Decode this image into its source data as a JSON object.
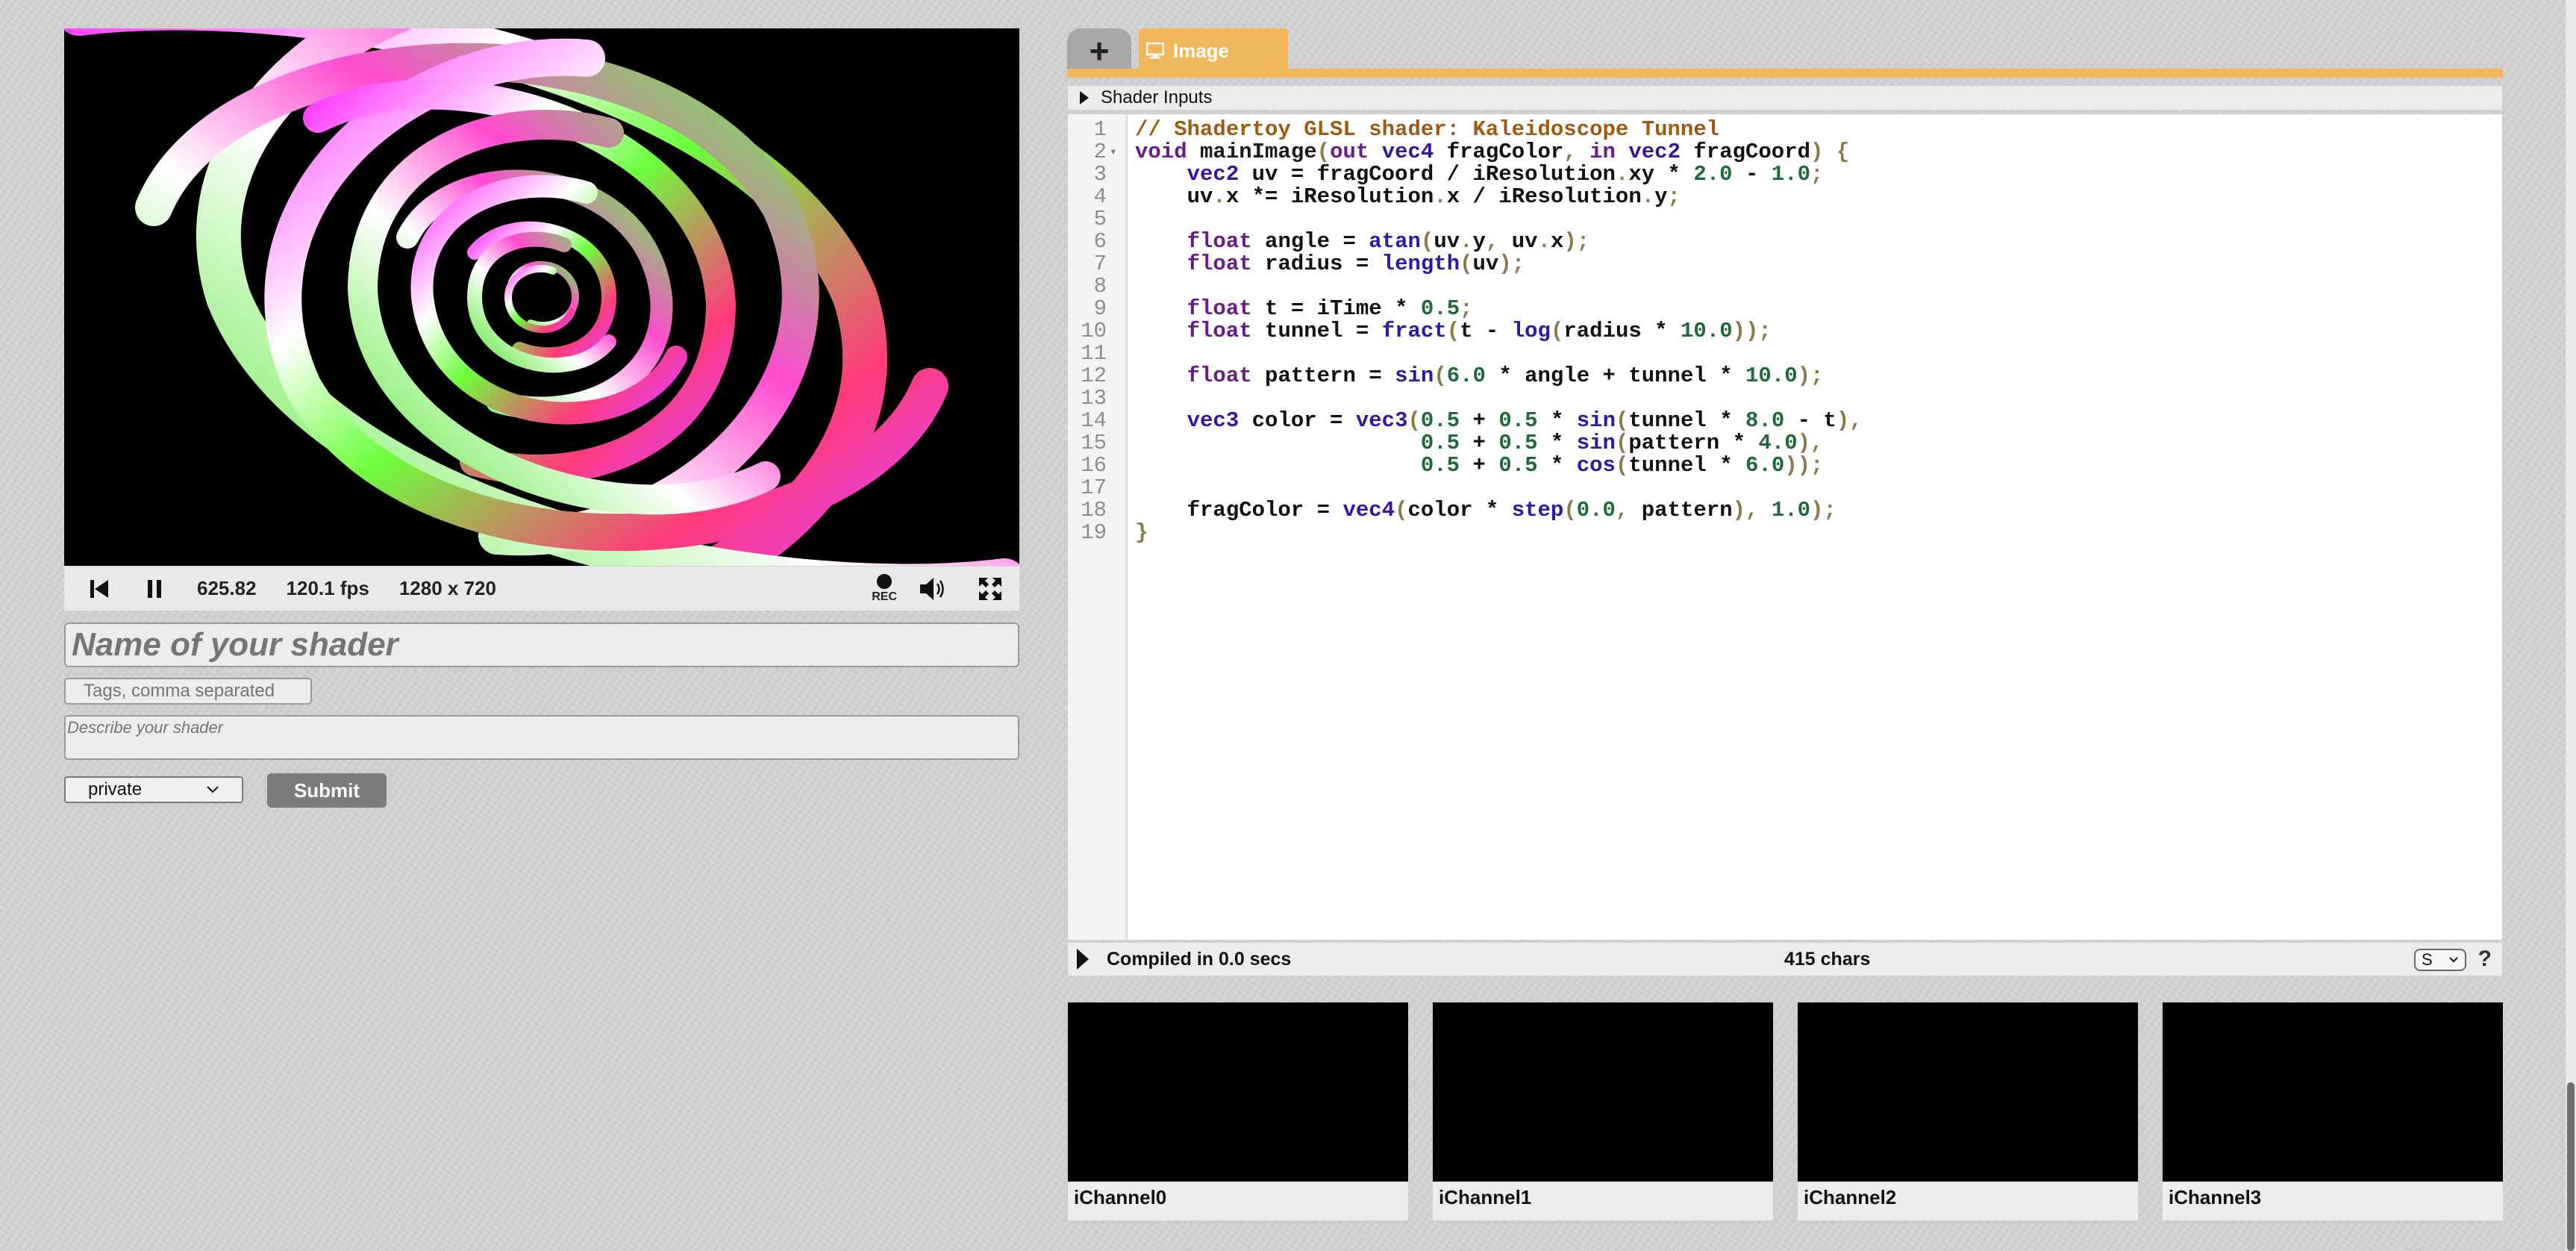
{
  "player": {
    "time": "625.82",
    "fps": "120.1 fps",
    "resolution": "1280 x 720",
    "rec_label": "REC"
  },
  "form": {
    "name_placeholder": "Name of your shader",
    "tags_placeholder": "Tags, comma separated",
    "description_placeholder": "Describe your shader",
    "visibility_selected": "private",
    "submit_label": "Submit"
  },
  "tabs": {
    "add_label": "+",
    "image_label": "Image"
  },
  "shader_inputs_label": "Shader Inputs",
  "editor": {
    "lines": [
      [
        [
          "c-cmt",
          "// Shadertoy GLSL shader: Kaleidoscope Tunnel"
        ]
      ],
      [
        [
          "c-kw",
          "void "
        ],
        [
          "c-fn",
          "mainImage"
        ],
        [
          "c-pun",
          "("
        ],
        [
          "c-kw",
          "out "
        ],
        [
          "c-type",
          "vec4 "
        ],
        [
          "c-var",
          "fragColor"
        ],
        [
          "c-pun",
          ", "
        ],
        [
          "c-kw",
          "in "
        ],
        [
          "c-type",
          "vec2 "
        ],
        [
          "c-var",
          "fragCoord"
        ],
        [
          "c-pun",
          ") {"
        ]
      ],
      [
        [
          "c-var",
          "    "
        ],
        [
          "c-type",
          "vec2 "
        ],
        [
          "c-var",
          "uv = fragCoord / iResolution"
        ],
        [
          "c-pun",
          "."
        ],
        [
          "c-var",
          "xy * "
        ],
        [
          "c-num",
          "2.0"
        ],
        [
          "c-var",
          " - "
        ],
        [
          "c-num",
          "1.0"
        ],
        [
          "c-pun",
          ";"
        ]
      ],
      [
        [
          "c-var",
          "    uv"
        ],
        [
          "c-pun",
          "."
        ],
        [
          "c-var",
          "x *= iResolution"
        ],
        [
          "c-pun",
          "."
        ],
        [
          "c-var",
          "x / iResolution"
        ],
        [
          "c-pun",
          "."
        ],
        [
          "c-var",
          "y"
        ],
        [
          "c-pun",
          ";"
        ]
      ],
      [],
      [
        [
          "c-var",
          "    "
        ],
        [
          "c-kw",
          "float "
        ],
        [
          "c-var",
          "angle = "
        ],
        [
          "c-bi",
          "atan"
        ],
        [
          "c-pun",
          "("
        ],
        [
          "c-var",
          "uv"
        ],
        [
          "c-pun",
          "."
        ],
        [
          "c-var",
          "y"
        ],
        [
          "c-pun",
          ", "
        ],
        [
          "c-var",
          "uv"
        ],
        [
          "c-pun",
          "."
        ],
        [
          "c-var",
          "x"
        ],
        [
          "c-pun",
          ");"
        ]
      ],
      [
        [
          "c-var",
          "    "
        ],
        [
          "c-kw",
          "float "
        ],
        [
          "c-var",
          "radius = "
        ],
        [
          "c-bi",
          "length"
        ],
        [
          "c-pun",
          "("
        ],
        [
          "c-var",
          "uv"
        ],
        [
          "c-pun",
          ");"
        ]
      ],
      [],
      [
        [
          "c-var",
          "    "
        ],
        [
          "c-kw",
          "float "
        ],
        [
          "c-var",
          "t = iTime * "
        ],
        [
          "c-num",
          "0.5"
        ],
        [
          "c-pun",
          ";"
        ]
      ],
      [
        [
          "c-var",
          "    "
        ],
        [
          "c-kw",
          "float "
        ],
        [
          "c-var",
          "tunnel = "
        ],
        [
          "c-bi",
          "fract"
        ],
        [
          "c-pun",
          "("
        ],
        [
          "c-var",
          "t - "
        ],
        [
          "c-bi",
          "log"
        ],
        [
          "c-pun",
          "("
        ],
        [
          "c-var",
          "radius * "
        ],
        [
          "c-num",
          "10.0"
        ],
        [
          "c-pun",
          "));"
        ]
      ],
      [],
      [
        [
          "c-var",
          "    "
        ],
        [
          "c-kw",
          "float "
        ],
        [
          "c-var",
          "pattern = "
        ],
        [
          "c-bi",
          "sin"
        ],
        [
          "c-pun",
          "("
        ],
        [
          "c-num",
          "6.0"
        ],
        [
          "c-var",
          " * angle + tunnel * "
        ],
        [
          "c-num",
          "10.0"
        ],
        [
          "c-pun",
          ");"
        ]
      ],
      [],
      [
        [
          "c-var",
          "    "
        ],
        [
          "c-type",
          "vec3 "
        ],
        [
          "c-var",
          "color = "
        ],
        [
          "c-type",
          "vec3"
        ],
        [
          "c-pun",
          "("
        ],
        [
          "c-num",
          "0.5"
        ],
        [
          "c-var",
          " + "
        ],
        [
          "c-num",
          "0.5"
        ],
        [
          "c-var",
          " * "
        ],
        [
          "c-bi",
          "sin"
        ],
        [
          "c-pun",
          "("
        ],
        [
          "c-var",
          "tunnel * "
        ],
        [
          "c-num",
          "8.0"
        ],
        [
          "c-var",
          " - t"
        ],
        [
          "c-pun",
          "),"
        ]
      ],
      [
        [
          "c-var",
          "                      "
        ],
        [
          "c-num",
          "0.5"
        ],
        [
          "c-var",
          " + "
        ],
        [
          "c-num",
          "0.5"
        ],
        [
          "c-var",
          " * "
        ],
        [
          "c-bi",
          "sin"
        ],
        [
          "c-pun",
          "("
        ],
        [
          "c-var",
          "pattern * "
        ],
        [
          "c-num",
          "4.0"
        ],
        [
          "c-pun",
          "),"
        ]
      ],
      [
        [
          "c-var",
          "                      "
        ],
        [
          "c-num",
          "0.5"
        ],
        [
          "c-var",
          " + "
        ],
        [
          "c-num",
          "0.5"
        ],
        [
          "c-var",
          " * "
        ],
        [
          "c-bi",
          "cos"
        ],
        [
          "c-pun",
          "("
        ],
        [
          "c-var",
          "tunnel * "
        ],
        [
          "c-num",
          "6.0"
        ],
        [
          "c-pun",
          "));"
        ]
      ],
      [],
      [
        [
          "c-var",
          "    fragColor = "
        ],
        [
          "c-type",
          "vec4"
        ],
        [
          "c-pun",
          "("
        ],
        [
          "c-var",
          "color * "
        ],
        [
          "c-bi",
          "step"
        ],
        [
          "c-pun",
          "("
        ],
        [
          "c-num",
          "0.0"
        ],
        [
          "c-pun",
          ", "
        ],
        [
          "c-var",
          "pattern"
        ],
        [
          "c-pun",
          "), "
        ],
        [
          "c-num",
          "1.0"
        ],
        [
          "c-pun",
          ");"
        ]
      ],
      [
        [
          "c-pun",
          "}"
        ]
      ]
    ]
  },
  "status": {
    "compiled": "Compiled in 0.0 secs",
    "chars": "415 chars",
    "font_size": "S",
    "help": "?"
  },
  "channels": [
    "iChannel0",
    "iChannel1",
    "iChannel2",
    "iChannel3"
  ],
  "colors": {
    "tab_accent": "#f0b85a",
    "button_gray": "#7b7b7b"
  }
}
